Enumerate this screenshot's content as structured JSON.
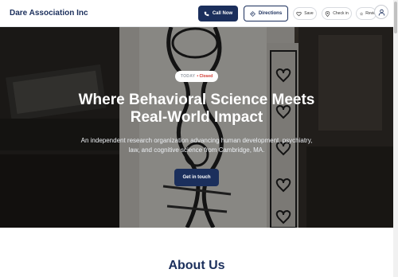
{
  "header": {
    "brand": "Dare Association Inc",
    "call_label": "Call Now",
    "directions_label": "Directions",
    "save_label": "Save",
    "checkin_label": "Check in",
    "reviews_label": "Revie"
  },
  "hero": {
    "status_today": "TODAY",
    "status_closed": "• Closed",
    "title_line1": "Where Behavioral Science Meets",
    "title_line2": "Real-World Impact",
    "subtitle_line1": "An independent research organization advancing human development, psychiatry,",
    "subtitle_line2": "law, and cognitive science from Cambridge, MA.",
    "cta_label": "Get in touch"
  },
  "about": {
    "title": "About Us"
  },
  "colors": {
    "primary": "#1b2f5c",
    "closed": "#d0342c",
    "white": "#ffffff"
  },
  "icons": [
    "phone-icon",
    "directions-icon",
    "heart-icon",
    "location-pin-icon",
    "star-icon",
    "user-icon"
  ]
}
